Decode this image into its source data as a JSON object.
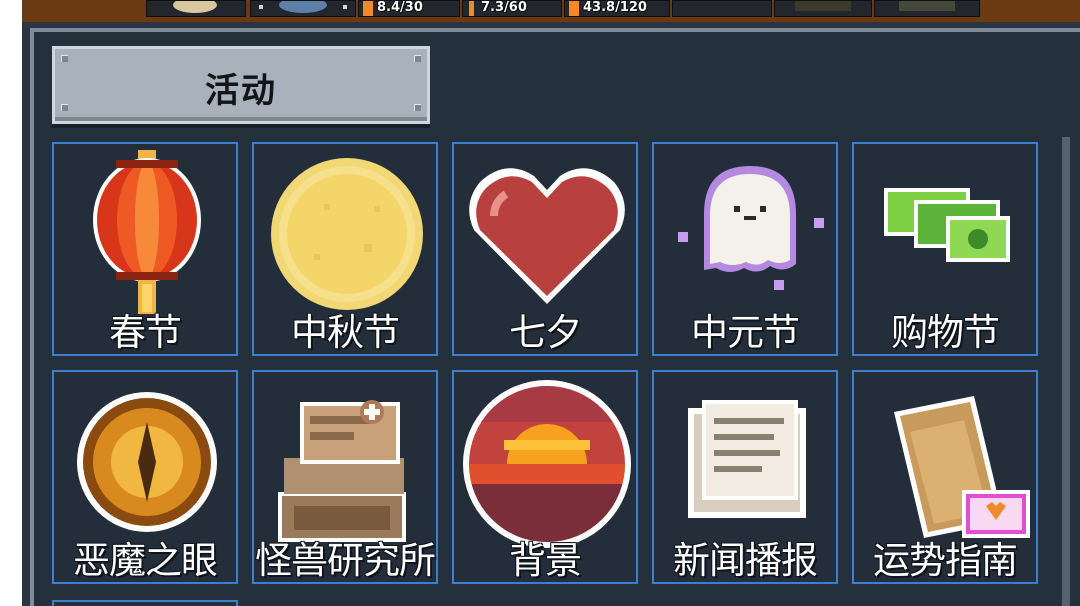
{
  "resources": [
    {
      "icon": "meat-icon",
      "value": "8.4/30"
    },
    {
      "icon": "energy-icon",
      "value": "7.3/60"
    },
    {
      "icon": "stamina-icon",
      "value": "43.8/120"
    }
  ],
  "panel": {
    "title": "活动"
  },
  "activities": [
    {
      "label": "春节",
      "icon": "lantern-icon"
    },
    {
      "label": "中秋节",
      "icon": "full-moon-icon"
    },
    {
      "label": "七夕",
      "icon": "heart-icon"
    },
    {
      "label": "中元节",
      "icon": "ghost-icon"
    },
    {
      "label": "购物节",
      "icon": "cash-icon"
    },
    {
      "label": "恶魔之眼",
      "icon": "demon-eye-icon"
    },
    {
      "label": "怪兽研究所",
      "icon": "monster-lab-icon"
    },
    {
      "label": "背景",
      "icon": "sunset-icon"
    },
    {
      "label": "新闻播报",
      "icon": "newspaper-icon"
    },
    {
      "label": "运势指南",
      "icon": "fortune-scroll-icon"
    }
  ],
  "colors": {
    "panel_bg": "#25303d",
    "tile_border": "#3b7fd1",
    "title_plate": "#a9b2bc"
  }
}
